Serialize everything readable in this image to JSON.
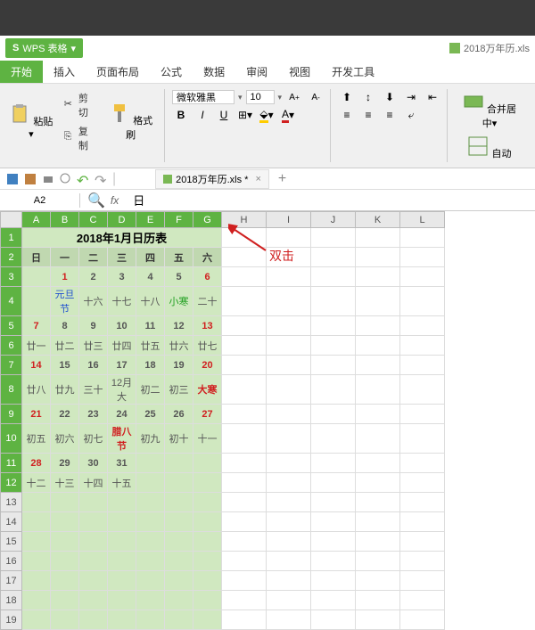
{
  "app": {
    "name": "WPS 表格",
    "logo": "S"
  },
  "file": {
    "label": "2018万年历.xls"
  },
  "tabs": [
    "开始",
    "插入",
    "页面布局",
    "公式",
    "数据",
    "审阅",
    "视图",
    "开发工具"
  ],
  "active_tab_index": 0,
  "clipboard": {
    "cut": "剪切",
    "copy": "复制",
    "format_painter": "格式刷",
    "paste": "粘贴"
  },
  "font": {
    "name": "微软雅黑",
    "size": "10",
    "bold": "B",
    "italic": "I",
    "underline": "U"
  },
  "merge": {
    "label": "合并居中",
    "auto": "自动"
  },
  "doc_tab": {
    "name": "2018万年历.xls *"
  },
  "name_box": "A2",
  "formula_value": "日",
  "annotation": "双击",
  "columns": [
    "A",
    "B",
    "C",
    "D",
    "E",
    "F",
    "G",
    "H",
    "I",
    "J",
    "K",
    "L"
  ],
  "rows": [
    "1",
    "2",
    "3",
    "4",
    "5",
    "6",
    "7",
    "8",
    "9",
    "10",
    "11",
    "12",
    "13",
    "14",
    "15",
    "16",
    "17",
    "18",
    "19"
  ],
  "calendar": {
    "title": "2018年1月日历表",
    "dow": [
      "日",
      "一",
      "二",
      "三",
      "四",
      "五",
      "六"
    ],
    "grid": [
      [
        {
          "t": ""
        },
        {
          "t": "1",
          "c": "red"
        },
        {
          "t": "2"
        },
        {
          "t": "3"
        },
        {
          "t": "4"
        },
        {
          "t": "5"
        },
        {
          "t": "6",
          "c": "red"
        }
      ],
      [
        {
          "t": ""
        },
        {
          "t": "元旦节",
          "c": "blue"
        },
        {
          "t": "十六"
        },
        {
          "t": "十七"
        },
        {
          "t": "十八"
        },
        {
          "t": "小寒",
          "c": "green"
        },
        {
          "t": "二十"
        }
      ],
      [
        {
          "t": "7",
          "c": "red"
        },
        {
          "t": "8"
        },
        {
          "t": "9"
        },
        {
          "t": "10"
        },
        {
          "t": "11"
        },
        {
          "t": "12"
        },
        {
          "t": "13",
          "c": "red"
        }
      ],
      [
        {
          "t": "廿一"
        },
        {
          "t": "廿二"
        },
        {
          "t": "廿三"
        },
        {
          "t": "廿四"
        },
        {
          "t": "廿五"
        },
        {
          "t": "廿六"
        },
        {
          "t": "廿七"
        }
      ],
      [
        {
          "t": "14",
          "c": "red"
        },
        {
          "t": "15"
        },
        {
          "t": "16"
        },
        {
          "t": "17"
        },
        {
          "t": "18"
        },
        {
          "t": "19"
        },
        {
          "t": "20",
          "c": "red"
        }
      ],
      [
        {
          "t": "廿八"
        },
        {
          "t": "廿九"
        },
        {
          "t": "三十"
        },
        {
          "t": "12月大"
        },
        {
          "t": "初二"
        },
        {
          "t": "初三"
        },
        {
          "t": "大寒",
          "c": "red"
        }
      ],
      [
        {
          "t": "21",
          "c": "red"
        },
        {
          "t": "22"
        },
        {
          "t": "23"
        },
        {
          "t": "24"
        },
        {
          "t": "25"
        },
        {
          "t": "26"
        },
        {
          "t": "27",
          "c": "red"
        }
      ],
      [
        {
          "t": "初五"
        },
        {
          "t": "初六"
        },
        {
          "t": "初七"
        },
        {
          "t": "腊八节",
          "c": "red"
        },
        {
          "t": "初九"
        },
        {
          "t": "初十"
        },
        {
          "t": "十一"
        }
      ],
      [
        {
          "t": "28",
          "c": "red"
        },
        {
          "t": "29"
        },
        {
          "t": "30"
        },
        {
          "t": "31"
        },
        {
          "t": ""
        },
        {
          "t": ""
        },
        {
          "t": ""
        }
      ],
      [
        {
          "t": "十二"
        },
        {
          "t": "十三"
        },
        {
          "t": "十四"
        },
        {
          "t": "十五"
        },
        {
          "t": ""
        },
        {
          "t": ""
        },
        {
          "t": ""
        }
      ]
    ]
  }
}
